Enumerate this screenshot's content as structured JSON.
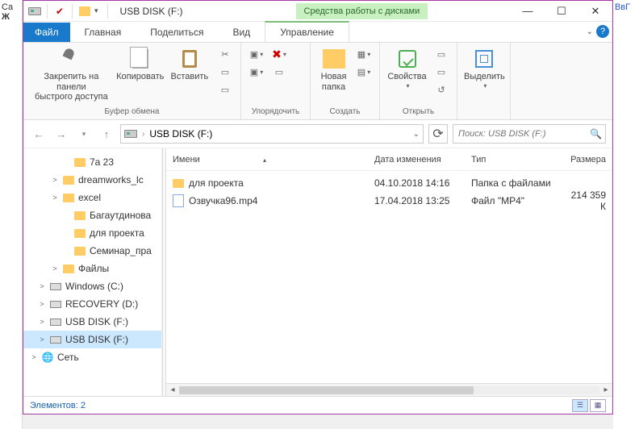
{
  "bg": {
    "left": "Ca",
    "left2": "Ж",
    "right": "ВвГ"
  },
  "title": "USB DISK (F:)",
  "context_tab": "Средства работы с дисками",
  "tabs": {
    "file": "Файл",
    "home": "Главная",
    "share": "Поделиться",
    "view": "Вид",
    "manage": "Управление"
  },
  "ribbon": {
    "pin": "Закрепить на панели\nбыстрого доступа",
    "copy": "Копировать",
    "paste": "Вставить",
    "grp_clipboard": "Буфер обмена",
    "grp_organize": "Упорядочить",
    "newfolder": "Новая\nпапка",
    "grp_create": "Создать",
    "properties": "Свойства",
    "grp_open": "Открыть",
    "select": "Выделить"
  },
  "breadcrumb": "USB DISK (F:)",
  "search_placeholder": "Поиск: USB DISK (F:)",
  "columns": {
    "name": "Имени",
    "date": "Дата изменения",
    "type": "Тип",
    "size": "Размера"
  },
  "rows": [
    {
      "icon": "folder",
      "name": "для проекта",
      "date": "04.10.2018 14:16",
      "type": "Папка с файлами",
      "size": ""
    },
    {
      "icon": "file",
      "name": "Озвучка96.mp4",
      "date": "17.04.2018 13:25",
      "type": "Файл \"MP4\"",
      "size": "214 359 К"
    }
  ],
  "tree": [
    {
      "lvl": 3,
      "exp": "",
      "icon": "folder",
      "label": "7а 23"
    },
    {
      "lvl": 2,
      "exp": ">",
      "icon": "folder",
      "label": "dreamworks_lc"
    },
    {
      "lvl": 2,
      "exp": ">",
      "icon": "folder",
      "label": "excel"
    },
    {
      "lvl": 3,
      "exp": "",
      "icon": "folder",
      "label": "Багаутдинова"
    },
    {
      "lvl": 3,
      "exp": "",
      "icon": "folder",
      "label": "для проекта"
    },
    {
      "lvl": 3,
      "exp": "",
      "icon": "folder",
      "label": "Семинар_пра"
    },
    {
      "lvl": 2,
      "exp": ">",
      "icon": "folder",
      "label": "Файлы"
    },
    {
      "lvl": 1,
      "exp": ">",
      "icon": "drive",
      "label": "Windows (C:)"
    },
    {
      "lvl": 1,
      "exp": ">",
      "icon": "drive",
      "label": "RECOVERY (D:)"
    },
    {
      "lvl": 1,
      "exp": ">",
      "icon": "drive",
      "label": "USB DISK (F:)"
    },
    {
      "lvl": 1,
      "exp": ">",
      "icon": "drive",
      "label": "USB DISK (F:)",
      "sel": true
    },
    {
      "lvl": 0,
      "exp": ">",
      "icon": "net",
      "label": "Сеть"
    }
  ],
  "status": "Элементов: 2"
}
